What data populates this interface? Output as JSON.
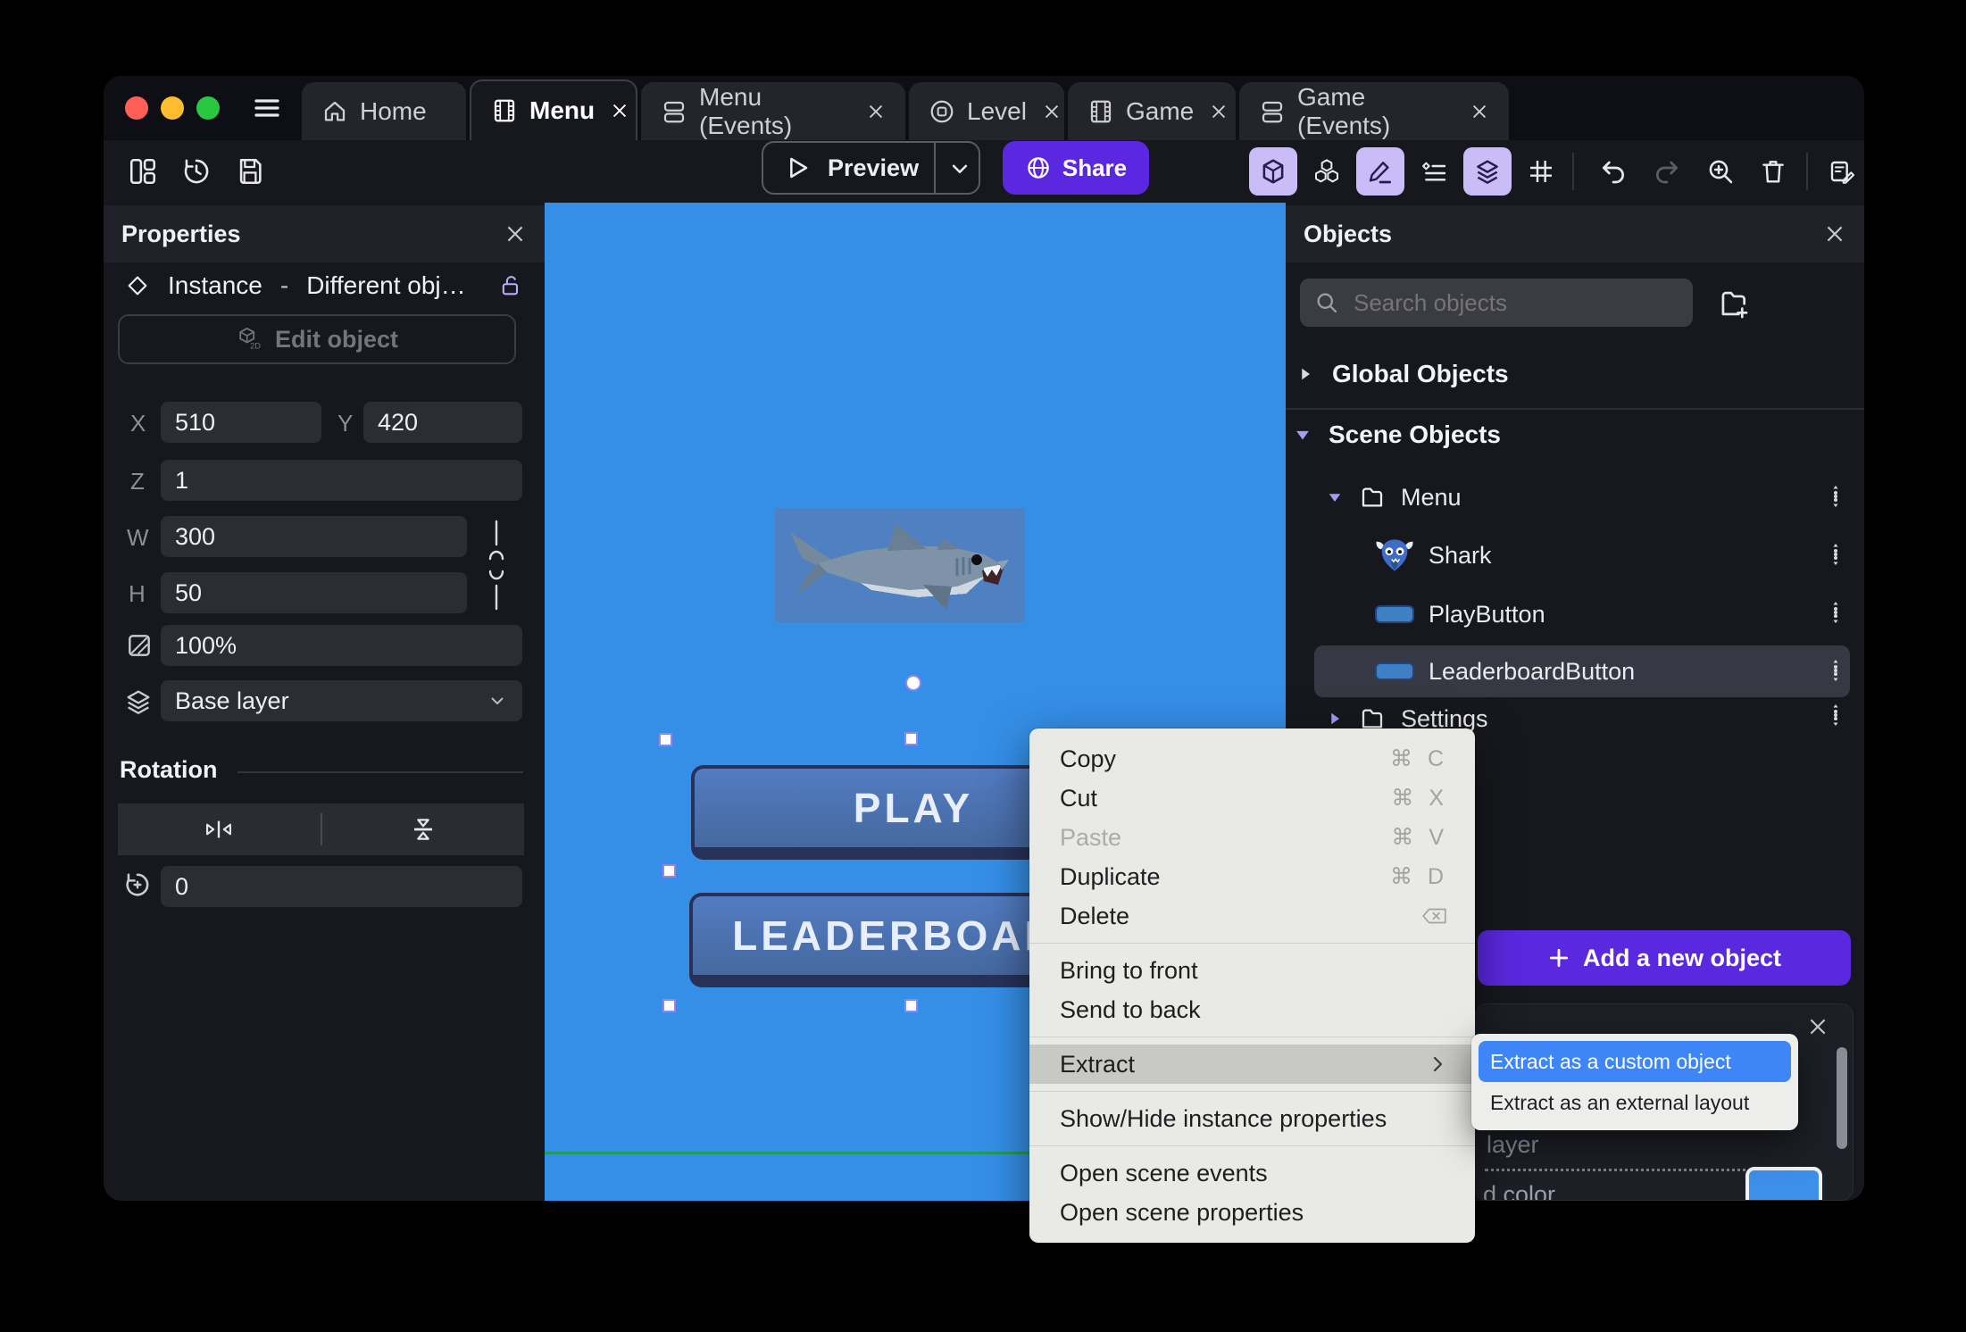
{
  "tabs": [
    {
      "label": "Home"
    },
    {
      "label": "Menu"
    },
    {
      "label": "Menu (Events)"
    },
    {
      "label": "Level"
    },
    {
      "label": "Game"
    },
    {
      "label": "Game (Events)"
    }
  ],
  "toolbar": {
    "preview_label": "Preview",
    "share_label": "Share"
  },
  "properties": {
    "title": "Properties",
    "instance_label": "Instance",
    "dash": "-",
    "object_label": "Different obj…",
    "edit_object_label": "Edit object",
    "x_label": "X",
    "x_value": "510",
    "y_label": "Y",
    "y_value": "420",
    "z_label": "Z",
    "z_value": "1",
    "w_label": "W",
    "w_value": "300",
    "h_label": "H",
    "h_value": "50",
    "opacity_value": "100%",
    "layer_value": "Base layer",
    "rotation_title": "Rotation",
    "rotation_value": "0"
  },
  "canvas": {
    "play_label": "PLAY",
    "leaderboard_label": "LEADERBOARD"
  },
  "objects_panel": {
    "title": "Objects",
    "search_placeholder": "Search objects",
    "global_section": "Global Objects",
    "scene_section": "Scene Objects",
    "items": [
      {
        "label": "Menu"
      },
      {
        "label": "Shark"
      },
      {
        "label": "PlayButton"
      },
      {
        "label": "LeaderboardButton"
      },
      {
        "label": "Settings"
      }
    ],
    "add_button_label": "Add a new object"
  },
  "context_menu": {
    "items": [
      {
        "label": "Copy",
        "shortcut": "⌘ C"
      },
      {
        "label": "Cut",
        "shortcut": "⌘ X"
      },
      {
        "label": "Paste",
        "shortcut": "⌘ V"
      },
      {
        "label": "Duplicate",
        "shortcut": "⌘ D"
      },
      {
        "label": "Delete",
        "shortcut": ""
      },
      {
        "label": "Bring to front",
        "shortcut": ""
      },
      {
        "label": "Send to back",
        "shortcut": ""
      },
      {
        "label": "Extract",
        "shortcut": ""
      },
      {
        "label": "Show/Hide instance properties",
        "shortcut": ""
      },
      {
        "label": "Open scene events",
        "shortcut": ""
      },
      {
        "label": "Open scene properties",
        "shortcut": ""
      }
    ]
  },
  "submenu": {
    "items": [
      {
        "label": "Extract as a custom object"
      },
      {
        "label": "Extract as an external layout"
      }
    ]
  },
  "bottom_panel": {
    "layer_fragment": "layer",
    "color_fragment": "d color",
    "swatch_color": "#3d8fe8"
  },
  "colors": {
    "accent_purple": "#5b27e0",
    "canvas_blue": "#358fe7",
    "selection_blue": "#3e86f7",
    "scene_boundary_green": "#219a5e",
    "toolbar_active_bg": "#c9bcf7"
  }
}
